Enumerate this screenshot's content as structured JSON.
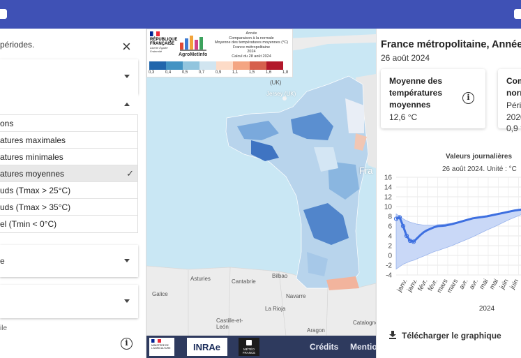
{
  "left_panel": {
    "intro_text": "périodes.",
    "list_items": [
      {
        "label": "ons",
        "selected": false
      },
      {
        "label": "atures maximales",
        "selected": false
      },
      {
        "label": "atures minimales",
        "selected": false
      },
      {
        "label": "atures moyennes",
        "selected": true
      },
      {
        "label": "uds (Tmax > 25°C)",
        "selected": false
      },
      {
        "label": "uds (Tmax > 35°C)",
        "selected": false
      },
      {
        "label": "el (Tmin < 0°C)",
        "selected": false
      }
    ],
    "accordion_label": "e",
    "small_label": "ile",
    "selected_mark": "✓",
    "close_glyph": "×"
  },
  "map": {
    "legend": {
      "republic_name": "RÉPUBLIQUE FRANÇAISE",
      "motto": "Liberté Égalité Fraternité",
      "brand": "AgroMetInfo",
      "title_lines": [
        "Année",
        "Comparaison à la normale",
        "Moyenne des températures moyennes (°C)",
        "France métropolitaine",
        "2024",
        "Calcul du 28 août 2024"
      ],
      "scale_colors": [
        "#2166ac",
        "#4393c3",
        "#92c5de",
        "#d1e5f0",
        "#fddbc7",
        "#f4a582",
        "#d6604d",
        "#b2182b"
      ],
      "tick_values": [
        "0,3",
        "0,4",
        "0,5",
        "0,7",
        "0,9",
        "1,1",
        "1,5",
        "1,6",
        "1,8"
      ]
    },
    "place_labels": [
      {
        "text": "(UK)",
        "cls": ""
      },
      {
        "text": "Jersey (UK)",
        "cls": "white"
      },
      {
        "text": "Fra",
        "cls": "white"
      },
      {
        "text": "Bilbao",
        "cls": ""
      },
      {
        "text": "Asturies",
        "cls": ""
      },
      {
        "text": "Cantabrie",
        "cls": ""
      },
      {
        "text": "Galice",
        "cls": ""
      },
      {
        "text": "Navarre",
        "cls": ""
      },
      {
        "text": "La Rioja",
        "cls": ""
      },
      {
        "text": "Castille-et-León",
        "cls": ""
      },
      {
        "text": "Aragon",
        "cls": ""
      },
      {
        "text": "Catalogne",
        "cls": ""
      }
    ]
  },
  "footer": {
    "inrae_label": "INRAe",
    "ministry_label": "MINISTÈRE DE L'AGRICULTURE",
    "meteo_label": "MÉTÉO FRANCE",
    "credits_label": "Crédits",
    "mentions_label": "Mentio"
  },
  "right_panel": {
    "title": "France métropolitaine, Année",
    "date": "26 août 2024",
    "card1": {
      "heading": "Moyenne des températures moyennes",
      "value": "12,6 °C"
    },
    "card2": {
      "heading": "Com norm",
      "period": "Péric 2020",
      "value": "0,9 °"
    },
    "chart_title": "Valeurs journalières",
    "chart_subtitle": "26 août 2024. Unité : °C",
    "download_label": "Télécharger le graphique"
  },
  "chart_data": {
    "type": "area",
    "title": "Valeurs journalières",
    "subtitle": "26 août 2024. Unité : °C",
    "xlabel": "2024",
    "ylabel": "",
    "ylim": [
      -4,
      16
    ],
    "yticks": [
      -4,
      -2,
      0,
      2,
      4,
      6,
      8,
      10,
      12,
      14,
      16
    ],
    "x_categories": [
      "janv.",
      "janv.",
      "févr.",
      "févr.",
      "mars",
      "mars",
      "avr.",
      "avr.",
      "mai",
      "mai",
      "juin",
      "juin"
    ],
    "x": [
      0,
      5,
      10,
      15,
      20,
      25,
      30,
      35,
      40,
      45,
      50,
      55,
      60,
      70,
      80,
      90,
      100,
      110,
      120,
      130,
      140,
      150,
      160,
      170,
      180
    ],
    "series": [
      {
        "values": [
          7.5,
          7.8,
          6.0,
          4.0,
          3.0,
          2.8,
          3.5,
          4.2,
          4.8,
          5.2,
          5.5,
          5.8,
          6.0,
          6.1,
          6.4,
          6.8,
          7.2,
          7.6,
          7.8,
          8.0,
          8.3,
          8.6,
          8.9,
          9.2,
          9.4
        ]
      }
    ],
    "band_upper": [
      8.5,
      8.0,
      7.5,
      7.1,
      6.8,
      6.6,
      6.4,
      6.3,
      6.2,
      6.2,
      6.2,
      6.2,
      6.3,
      6.4,
      6.6,
      6.9,
      7.2,
      7.5,
      7.8,
      8.1,
      8.4,
      8.7,
      9.0,
      9.2,
      9.4
    ],
    "band_lower": [
      -2.8,
      -2.3,
      -1.8,
      -1.5,
      -1.2,
      -1.0,
      -0.7,
      -0.4,
      -0.1,
      0.2,
      0.5,
      0.8,
      1.0,
      1.5,
      2.0,
      2.6,
      3.2,
      3.8,
      4.5,
      5.2,
      5.8,
      6.5,
      7.2,
      7.8,
      8.4
    ],
    "colors": {
      "line": "#3d6fe0",
      "band": "#c9d8f7",
      "band_stroke": "#9ab4ec"
    },
    "grid": true,
    "legend": "none"
  }
}
